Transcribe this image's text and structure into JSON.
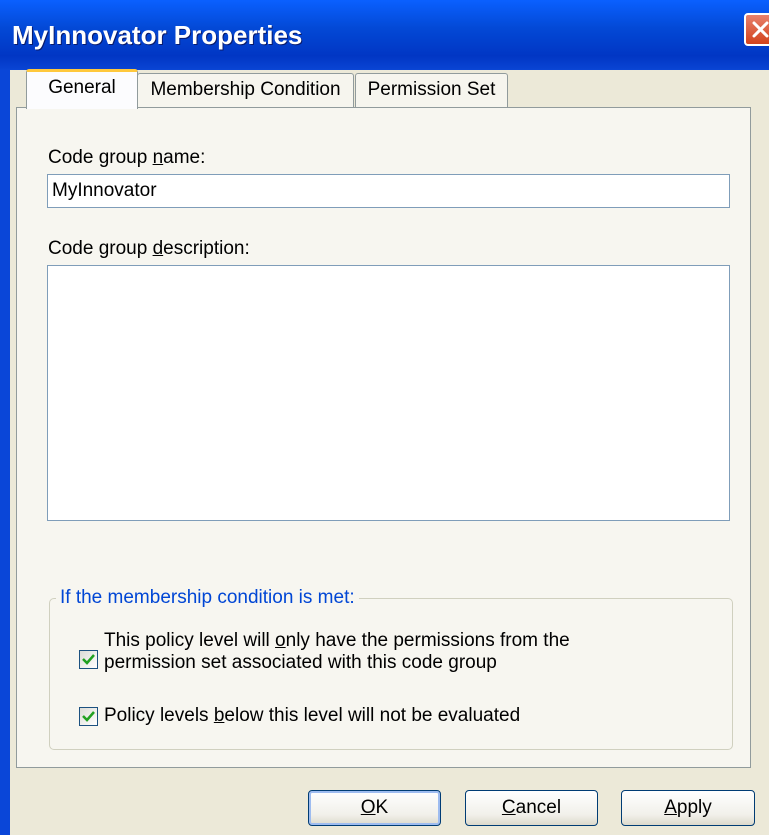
{
  "window": {
    "title": "MyInnovator Properties"
  },
  "tabs": [
    {
      "label": "General"
    },
    {
      "label": "Membership Condition"
    },
    {
      "label": "Permission Set"
    }
  ],
  "general": {
    "name_label_pre": "Code group ",
    "name_label_u": "n",
    "name_label_post": "ame:",
    "name_value": "MyInnovator",
    "desc_label_pre": "Code group ",
    "desc_label_u": "d",
    "desc_label_post": "escription:",
    "desc_value": ""
  },
  "group": {
    "legend": "If the membership condition is met:",
    "check1_line1_pre": "This policy level will ",
    "check1_line1_u": "o",
    "check1_line1_post": "nly have the permissions from the",
    "check1_line2": "permission set associated with this code group",
    "check1_checked": true,
    "check2_pre": "Policy levels ",
    "check2_u": "b",
    "check2_post": "elow this level will not be evaluated",
    "check2_checked": true
  },
  "buttons": {
    "ok_u": "O",
    "ok_rest": "K",
    "cancel_u": "C",
    "cancel_rest": "ancel",
    "apply_u": "A",
    "apply_rest": "pply"
  }
}
